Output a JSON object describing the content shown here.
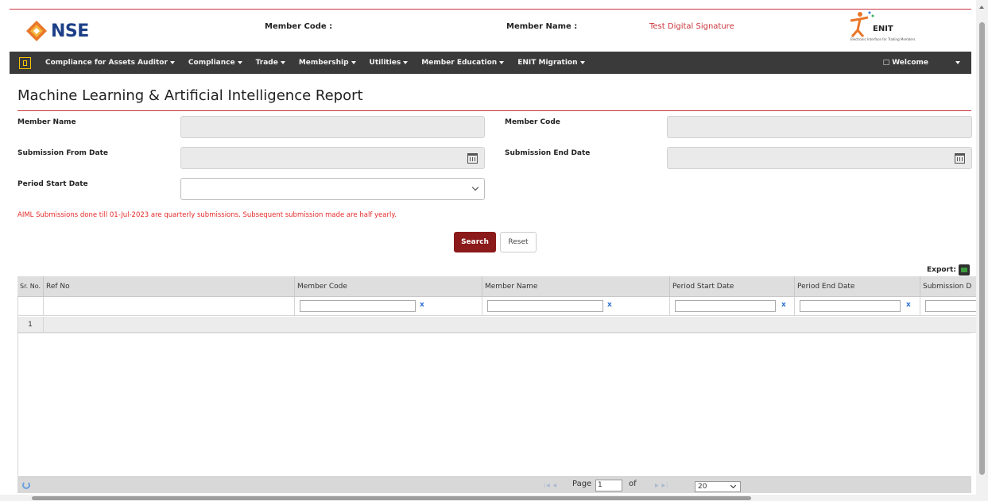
{
  "header": {
    "logo_text": "NSE",
    "member_code_label": "Member Code :",
    "member_name_label": "Member Name :",
    "member_name_value": "Test Digital Signature",
    "enit_logo_text": "ENIT",
    "enit_logo_subtitle": "Electronic Interface for Trading Members"
  },
  "nav": {
    "items": [
      {
        "label": "Compliance for Assets Auditor"
      },
      {
        "label": "Compliance"
      },
      {
        "label": "Trade"
      },
      {
        "label": "Membership"
      },
      {
        "label": "Utilities"
      },
      {
        "label": "Member Education"
      },
      {
        "label": "ENIT Migration"
      }
    ],
    "welcome_label": "Welcome"
  },
  "page": {
    "title": "Machine Learning & Artificial Intelligence Report"
  },
  "form": {
    "member_name_label": "Member Name",
    "member_code_label": "Member Code",
    "submission_from_label": "Submission From Date",
    "submission_end_label": "Submission End Date",
    "period_start_label": "Period Start Date",
    "notice": "AIML Submissions done till 01-Jul-2023 are quarterly submissions. Subsequent submission made are half yearly.",
    "search_label": "Search",
    "reset_label": "Reset",
    "export_label": "Export:"
  },
  "grid": {
    "columns": [
      "Sr. No.",
      "Ref No",
      "Member Code",
      "Member Name",
      "Period Start Date",
      "Period End Date",
      "Submission D"
    ],
    "clear_symbol": "x",
    "rows": [
      {
        "sr_no": "1"
      }
    ]
  },
  "pager": {
    "page_label": "Page",
    "page_value": "1",
    "of_label": "of",
    "page_size": "20"
  },
  "colors": {
    "accent_red": "#c9343a",
    "nav_bg": "#3a3a3a",
    "search_btn": "#8b1a1a",
    "notice_red": "#e52a2a"
  }
}
